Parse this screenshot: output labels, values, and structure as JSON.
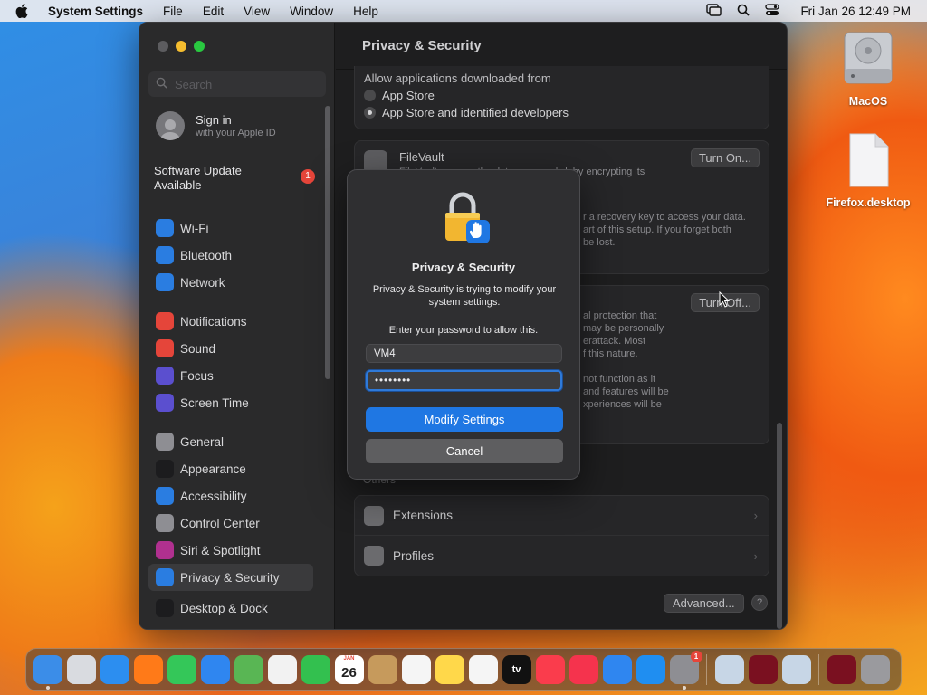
{
  "menubar": {
    "app_name": "System Settings",
    "items": [
      "File",
      "Edit",
      "View",
      "Window",
      "Help"
    ],
    "clock": "Fri Jan 26  12:49 PM"
  },
  "desktop": {
    "icons": [
      {
        "label": "MacOS",
        "icon": "hard-drive-icon"
      },
      {
        "label": "Firefox.desktop",
        "icon": "document-icon"
      }
    ]
  },
  "window": {
    "search_placeholder": "Search",
    "account": {
      "title": "Sign in",
      "subtitle": "with your Apple ID"
    },
    "software_update": {
      "label": "Software Update\nAvailable",
      "badge": "1"
    },
    "nav_group1": [
      {
        "label": "Wi-Fi",
        "icon": "wifi-icon",
        "color": "#2a7de1"
      },
      {
        "label": "Bluetooth",
        "icon": "bluetooth-icon",
        "color": "#2a7de1"
      },
      {
        "label": "Network",
        "icon": "globe-icon",
        "color": "#2a7de1"
      }
    ],
    "nav_group2": [
      {
        "label": "Notifications",
        "icon": "bell-icon",
        "color": "#e5453a"
      },
      {
        "label": "Sound",
        "icon": "speaker-icon",
        "color": "#e5453a"
      },
      {
        "label": "Focus",
        "icon": "moon-icon",
        "color": "#5b4fcf"
      },
      {
        "label": "Screen Time",
        "icon": "hourglass-icon",
        "color": "#5b4fcf"
      }
    ],
    "nav_group3": [
      {
        "label": "General",
        "icon": "gear-icon",
        "color": "#8e8e93"
      },
      {
        "label": "Appearance",
        "icon": "appearance-icon",
        "color": "#1c1c1e"
      },
      {
        "label": "Accessibility",
        "icon": "accessibility-icon",
        "color": "#2a7de1"
      },
      {
        "label": "Control Center",
        "icon": "control-center-icon",
        "color": "#8e8e93"
      },
      {
        "label": "Siri & Spotlight",
        "icon": "siri-icon",
        "color": "#b0308f"
      },
      {
        "label": "Privacy & Security",
        "icon": "hand-icon",
        "color": "#2a7de1"
      }
    ],
    "nav_group4": [
      {
        "label": "Desktop & Dock",
        "icon": "dock-icon",
        "color": "#1c1c1e"
      }
    ],
    "content_title": "Privacy & Security",
    "allow_apps": {
      "heading": "Allow applications downloaded from",
      "option1": "App Store",
      "option2": "App Store and identified developers"
    },
    "filevault": {
      "title": "FileVault",
      "desc": "FileVault secures the data on your disk by encrypting its",
      "button": "Turn On...",
      "ghost1": "r a recovery key to access your data.",
      "ghost2": "art of this setup. If you forget both",
      "ghost3": "be lost."
    },
    "lockdown": {
      "button": "Turn Off...",
      "ghost": [
        "al protection that",
        "may be personally",
        "erattack. Most",
        "f this nature.",
        "",
        "not function as it",
        "and features will be",
        "xperiences will be"
      ]
    },
    "others_label": "Others",
    "rows": [
      {
        "label": "Extensions",
        "icon": "extensions-icon"
      },
      {
        "label": "Profiles",
        "icon": "profiles-icon"
      }
    ],
    "advanced_button": "Advanced...",
    "help_button": "?"
  },
  "dialog": {
    "title": "Privacy & Security",
    "message": "Privacy & Security is trying to modify your system settings.",
    "prompt": "Enter your password to allow this.",
    "username": "VM4",
    "password": "••••••••",
    "primary_button": "Modify Settings",
    "cancel_button": "Cancel"
  },
  "dock": {
    "apps": [
      {
        "name": "finder-icon",
        "color": "#3b8de8"
      },
      {
        "name": "launchpad-icon",
        "color": "#d9dbe0"
      },
      {
        "name": "safari-icon",
        "color": "#2c8ef0"
      },
      {
        "name": "firefox-icon",
        "color": "#ff7a18"
      },
      {
        "name": "messages-icon",
        "color": "#34c759"
      },
      {
        "name": "mail-icon",
        "color": "#2f86f0"
      },
      {
        "name": "maps-icon",
        "color": "#59b654"
      },
      {
        "name": "photos-icon",
        "color": "#f2f2f2"
      },
      {
        "name": "facetime-icon",
        "color": "#33c04f"
      },
      {
        "name": "calendar-icon",
        "color": "#ffffff",
        "text": "26",
        "caption": "JAN"
      },
      {
        "name": "contacts-icon",
        "color": "#c69a5c"
      },
      {
        "name": "reminders-icon",
        "color": "#f5f5f5"
      },
      {
        "name": "notes-icon",
        "color": "#ffd84a"
      },
      {
        "name": "freeform-icon",
        "color": "#f5f5f5"
      },
      {
        "name": "tv-icon",
        "color": "#111111",
        "text": "tv"
      },
      {
        "name": "music-icon",
        "color": "#fa3c4c"
      },
      {
        "name": "news-icon",
        "color": "#f5334d"
      },
      {
        "name": "keynote-icon",
        "color": "#2f86f0"
      },
      {
        "name": "app-store-icon",
        "color": "#1f8ef1"
      },
      {
        "name": "system-settings-icon",
        "color": "#8e8e93",
        "badge": "1"
      }
    ],
    "others": [
      {
        "name": "wine-installer-icon",
        "color": "#c7d6e6"
      },
      {
        "name": "wine-icon",
        "color": "#7a1020"
      },
      {
        "name": "disk-utility-icon",
        "color": "#c7d6e6"
      }
    ],
    "trailing": [
      {
        "name": "wine-app-icon",
        "color": "#7a1020"
      },
      {
        "name": "trash-icon",
        "color": "#9a9a9e"
      }
    ]
  }
}
